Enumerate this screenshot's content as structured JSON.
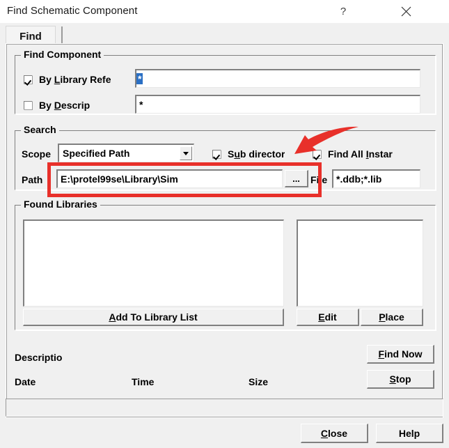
{
  "window": {
    "title": "Find Schematic Component",
    "help_icon": "question-mark-icon",
    "close_icon": "close-x-icon"
  },
  "tabs": [
    {
      "label": "Find",
      "active": true
    }
  ],
  "find_component": {
    "legend": "Find Component",
    "by_library_ref": {
      "label_prefix": "By ",
      "label_accel": "L",
      "label_suffix": "ibrary Refe",
      "checked": true,
      "value": "*",
      "value_selected": true
    },
    "by_description": {
      "label_prefix": "By ",
      "label_accel": "D",
      "label_suffix": "escrip",
      "checked": false,
      "value": "*",
      "value_selected": false
    }
  },
  "search": {
    "legend": "Search",
    "scope_label": "Scope",
    "scope_value": "Specified Path",
    "scope_options": [
      "Specified Path"
    ],
    "sub_directories": {
      "label_prefix": "S",
      "label_accel": "u",
      "label_suffix": "b director",
      "checked": true
    },
    "find_all_instances": {
      "label_prefix": "Find All ",
      "label_accel": "I",
      "label_suffix": "nstar",
      "checked": true
    },
    "path_label": "Path",
    "path_value": "E:\\protel99se\\Library\\Sim",
    "browse_label": "...",
    "file_label": "File",
    "file_value": "*.ddb;*.lib"
  },
  "found_libraries": {
    "legend": "Found Libraries",
    "left_list_items": [],
    "right_list_items": [],
    "add_to_library_list": {
      "prefix": "",
      "accel": "A",
      "suffix": "dd To Library List"
    },
    "edit": {
      "prefix": "",
      "accel": "E",
      "suffix": "dit"
    },
    "place": {
      "prefix": "",
      "accel": "P",
      "suffix": "lace"
    }
  },
  "results": {
    "description_label": "Descriptio",
    "date_label": "Date",
    "time_label": "Time",
    "size_label": "Size",
    "find_now": {
      "prefix": "",
      "accel": "F",
      "suffix": "ind Now"
    },
    "stop": {
      "prefix": "",
      "accel": "S",
      "suffix": "top"
    }
  },
  "footer": {
    "close": {
      "prefix": "",
      "accel": "C",
      "suffix": "lose"
    },
    "help": {
      "prefix": "",
      "accel": "",
      "suffix": "Help"
    }
  },
  "annotations": {
    "highlight_color": "#e8302a",
    "box_target": "path-field-row",
    "arrow_target": "sub-directories-checkbox"
  }
}
